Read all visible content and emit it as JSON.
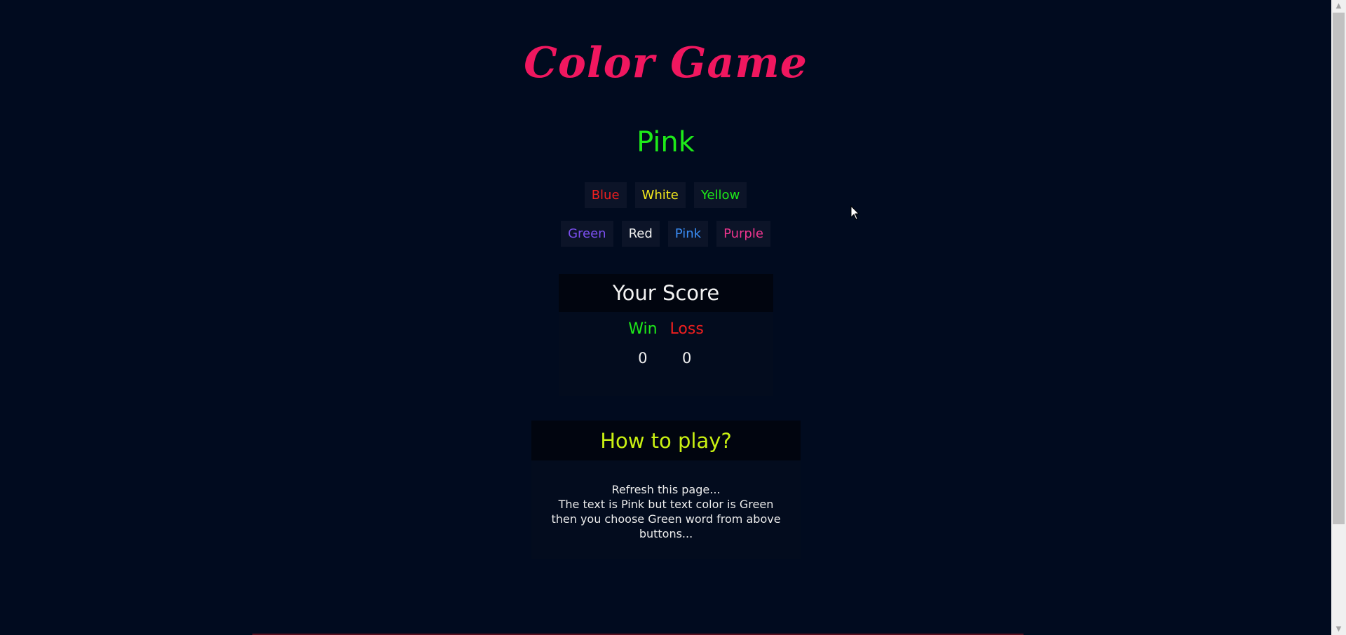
{
  "game": {
    "title": "Color Game",
    "target_word": "Pink",
    "target_color": "#1eea19",
    "buttons_row1": [
      {
        "label": "Blue",
        "color": "#f01f1f"
      },
      {
        "label": "White",
        "color": "#f2e81c"
      },
      {
        "label": "Yellow",
        "color": "#1eea19"
      }
    ],
    "buttons_row2": [
      {
        "label": "Green",
        "color": "#7b4ff0"
      },
      {
        "label": "Red",
        "color": "#f2f2f2"
      },
      {
        "label": "Pink",
        "color": "#3a8df5"
      },
      {
        "label": "Purple",
        "color": "#f0358f"
      }
    ]
  },
  "score": {
    "heading": "Your Score",
    "win_label": "Win",
    "loss_label": "Loss",
    "win_value": "0",
    "loss_value": "0",
    "win_color": "#1eea19",
    "loss_color": "#f01f1f"
  },
  "howto": {
    "heading": "How to play?",
    "line1": "Refresh this page...",
    "line2": "The text is Pink but text color is Green",
    "line3": "then you choose Green word from above",
    "line4": "buttons..."
  },
  "icons": {
    "cursor": "arrow-cursor-icon",
    "scroll_up": "scroll-up-arrow-icon",
    "scroll_down": "scroll-down-arrow-icon"
  }
}
